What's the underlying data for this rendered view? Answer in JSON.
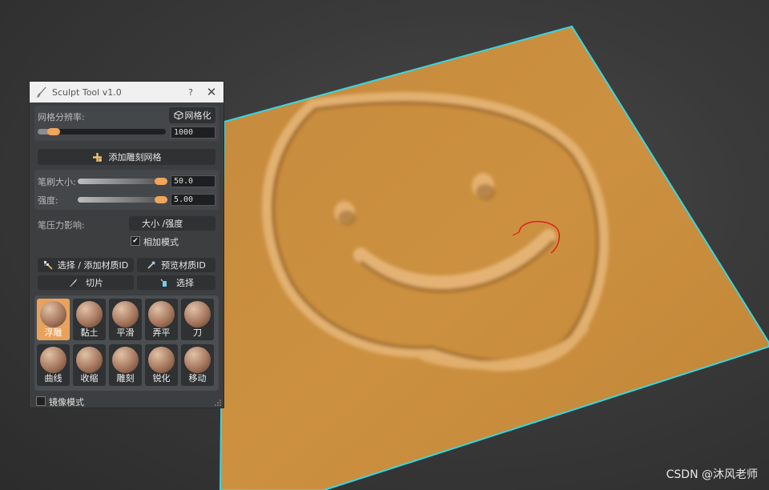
{
  "viewport": {
    "name": "3d-viewport",
    "plane_color": "#c78a3a",
    "edge_color": "#39d6e0"
  },
  "panel": {
    "title": "Sculpt Tool v1.0",
    "help_label": "?",
    "close_label": "✕",
    "mesh_res_label": "网格分辨率:",
    "mesh_button_label": "网格化",
    "mesh_res_value": "1000",
    "add_mesh_label": "添加雕刻网格",
    "brush_size_label": "笔刷大小:",
    "brush_size_value": "50.0",
    "strength_label": "强度:",
    "strength_value": "5.00",
    "pressure_label": "笔压力影响:",
    "pressure_option": "大小 /强度",
    "additive_label": "相加模式",
    "additive_checked": true,
    "select_add_mat_label": "选择 / 添加材质ID",
    "preview_mat_label": "预览材质ID",
    "slice_label": "切片",
    "select_label": "选择",
    "brushes": [
      {
        "label": "浮雕",
        "icon": "emboss-brush-icon",
        "selected": true
      },
      {
        "label": "黏土",
        "icon": "clay-brush-icon",
        "selected": false
      },
      {
        "label": "平滑",
        "icon": "smooth-brush-icon",
        "selected": false
      },
      {
        "label": "弄平",
        "icon": "flatten-brush-icon",
        "selected": false
      },
      {
        "label": "刀",
        "icon": "knife-brush-icon",
        "selected": false
      },
      {
        "label": "曲线",
        "icon": "curve-brush-icon",
        "selected": false
      },
      {
        "label": "收缩",
        "icon": "pinch-brush-icon",
        "selected": false
      },
      {
        "label": "雕刻",
        "icon": "carve-brush-icon",
        "selected": false
      },
      {
        "label": "锐化",
        "icon": "sharpen-brush-icon",
        "selected": false
      },
      {
        "label": "移动",
        "icon": "move-brush-icon",
        "selected": false
      }
    ],
    "mirror_label": "镜像模式",
    "mirror_checked": false,
    "accent": "#f0a55b"
  },
  "watermark": "CSDN @沐风老师"
}
